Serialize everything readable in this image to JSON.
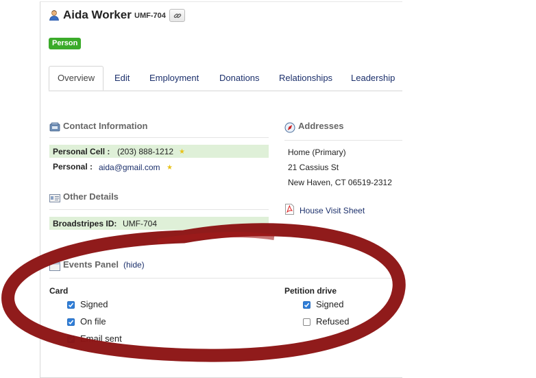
{
  "header": {
    "name": "Aida Worker",
    "id_code": "UMF-704",
    "badge": "Person"
  },
  "tabs": [
    {
      "label": "Overview",
      "active": true
    },
    {
      "label": "Edit"
    },
    {
      "label": "Employment"
    },
    {
      "label": "Donations"
    },
    {
      "label": "Relationships"
    },
    {
      "label": "Leadership"
    }
  ],
  "contact": {
    "title": "Contact Information",
    "cell_label": "Personal Cell :",
    "cell_value": "(203) 888-1212",
    "email_label": "Personal :",
    "email_value": "aida@gmail.com"
  },
  "other": {
    "title": "Other Details",
    "bs_label": "Broadstripes ID:",
    "bs_value": "UMF-704"
  },
  "addresses": {
    "title": "Addresses",
    "line1": "Home (Primary)",
    "line2": "21 Cassius St",
    "line3": "New Haven, CT 06519-2312",
    "sheet_link": "House Visit Sheet"
  },
  "events": {
    "title": "Events Panel",
    "hide_link": "(hide)",
    "card": {
      "title": "Card",
      "items": [
        {
          "label": "Signed",
          "checked": true
        },
        {
          "label": "On file",
          "checked": true
        },
        {
          "label": "Email sent",
          "checked": true
        }
      ]
    },
    "petition": {
      "title": "Petition drive",
      "items": [
        {
          "label": "Signed",
          "checked": true
        },
        {
          "label": "Refused",
          "checked": false
        }
      ]
    }
  },
  "colors": {
    "badge_green": "#3bab2a",
    "link_navy": "#1b2f6b",
    "highlight_green": "#dff0d8",
    "annotation_red": "#8c1414"
  }
}
